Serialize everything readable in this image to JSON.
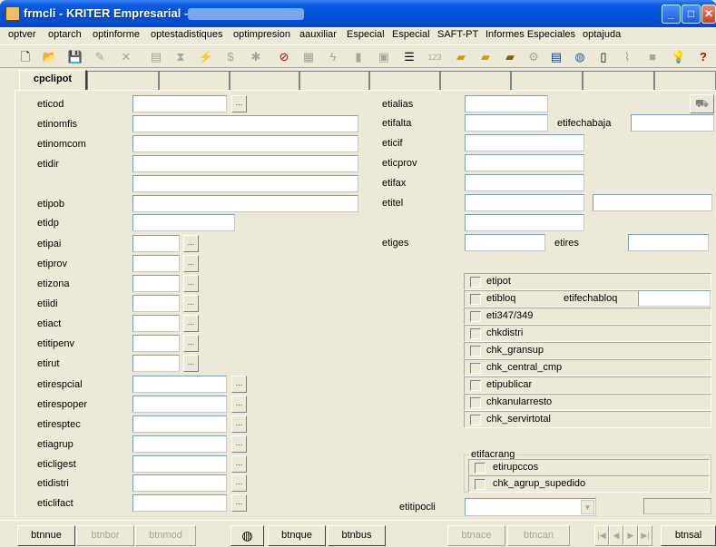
{
  "window": {
    "title": "frmcli - KRITER Empresarial -",
    "minimize": "_",
    "maximize": "□",
    "close": "✕"
  },
  "menu": [
    "optver",
    "optarch",
    "optinforme",
    "optestadistiques",
    "optimpresion",
    "aauxiliar",
    "Especial",
    "Especial",
    "SAFT-PT",
    "Informes Especiales",
    "optajuda"
  ],
  "toolbar_icons": [
    "new-document-icon",
    "open-folder-icon",
    "save-icon",
    "edit-icon",
    "delete-icon",
    "clipboard-icon",
    "filter-icon",
    "magic-icon",
    "dollar-icon",
    "bug-icon",
    "no-entry-icon",
    "grid-icon",
    "lightning-icon",
    "bar-chart-icon",
    "calculator-icon",
    "list-icon",
    "number-123-icon",
    "card-yellow-icon",
    "folder-card-icon",
    "card-blue-icon",
    "gear-card-icon",
    "calendar-icon",
    "globe-icon",
    "page-icon",
    "paperclip-icon",
    "square-icon",
    "lightbulb-icon",
    "help-icon"
  ],
  "tabs": [
    "cpclipot"
  ],
  "left_fields": [
    {
      "label": "eticod",
      "value": ""
    },
    {
      "label": "etinomfis",
      "value": ""
    },
    {
      "label": "etinomcom",
      "value": ""
    },
    {
      "label": "etidir",
      "value": ""
    },
    {
      "label": "etipob",
      "value": ""
    },
    {
      "label": "etidp",
      "value": ""
    },
    {
      "label": "etipai",
      "value": ""
    },
    {
      "label": "etiprov",
      "value": ""
    },
    {
      "label": "etizona",
      "value": ""
    },
    {
      "label": "etiidi",
      "value": ""
    },
    {
      "label": "etiact",
      "value": ""
    },
    {
      "label": "etitipenv",
      "value": ""
    },
    {
      "label": "etirut",
      "value": ""
    },
    {
      "label": "etirespcial",
      "value": ""
    },
    {
      "label": "etirespoper",
      "value": ""
    },
    {
      "label": "etiresptec",
      "value": ""
    },
    {
      "label": "etiagrup",
      "value": ""
    },
    {
      "label": "eticligest",
      "value": ""
    },
    {
      "label": "etidistri",
      "value": ""
    },
    {
      "label": "eticlifact",
      "value": ""
    }
  ],
  "right_fields": {
    "etialias": "etialias",
    "etifalta": "etifalta",
    "etifechabaja": "etifechabaja",
    "eticif": "eticif",
    "eticprov": "eticprov",
    "etifax": "etifax",
    "etitel": "etitel",
    "etiges": "etiges",
    "etires": "etires",
    "etitipocli": "etitipocli"
  },
  "checkboxes": [
    "etipot",
    "etibloq",
    "eti347/349",
    "chkdistri",
    "chk_gransup",
    "chk_central_cmp",
    "etipublicar",
    "chkanularresto",
    "chk_servirtotal"
  ],
  "etifechabloq": "etifechabloq",
  "group": {
    "title": "etifacrang",
    "items": [
      "etirupccos",
      "chk_agrup_supedido"
    ]
  },
  "bottom_buttons": {
    "btnnue": "btnnue",
    "btnbor": "btnbor",
    "btnmod": "btnmod",
    "btnque": "btnque",
    "btnbus": "btnbus",
    "btnace": "btnace",
    "btncan": "btncan",
    "btnsal": "btnsal"
  },
  "dots": "..."
}
